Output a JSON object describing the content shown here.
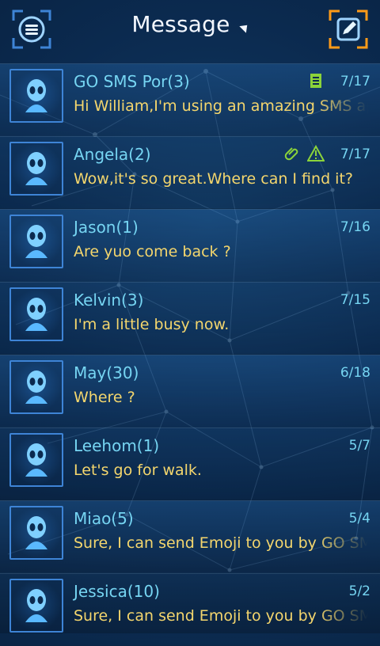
{
  "header": {
    "title": "Message"
  },
  "messages": [
    {
      "name": "GO SMS Por(3)",
      "preview": "Hi William,I'm using an amazing SMS ap",
      "date": "7/17",
      "icons": [
        "document-icon"
      ]
    },
    {
      "name": "Angela(2)",
      "preview": "Wow,it's so great.Where can I find it?",
      "date": "7/17",
      "icons": [
        "paperclip-icon",
        "warning-icon"
      ]
    },
    {
      "name": "Jason(1)",
      "preview": "Are yuo come back ?",
      "date": "7/16",
      "icons": []
    },
    {
      "name": "Kelvin(3)",
      "preview": "I'm a little busy now.",
      "date": "7/15",
      "icons": []
    },
    {
      "name": "May(30)",
      "preview": "Where ?",
      "date": "6/18",
      "icons": []
    },
    {
      "name": "Leehom(1)",
      "preview": "Let's go for walk.",
      "date": "5/7",
      "icons": []
    },
    {
      "name": "Miao(5)",
      "preview": "Sure, I can send Emoji to you by GO SMS",
      "date": "5/4",
      "icons": []
    },
    {
      "name": "Jessica(10)",
      "preview": "Sure, I can send Emoji to you by GO SMS",
      "date": "5/2",
      "icons": []
    }
  ],
  "colors": {
    "accent_blue": "#76d5f2",
    "preview_yellow": "#f4d66d",
    "frame_orange": "#ff9b18",
    "frame_blue": "#3e84d6"
  }
}
